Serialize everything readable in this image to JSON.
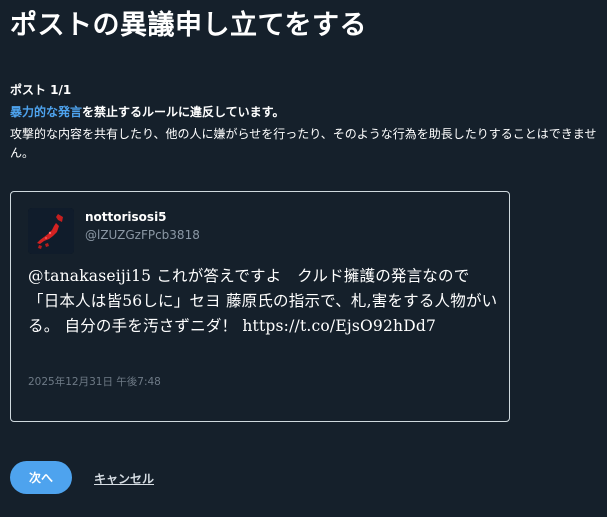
{
  "page": {
    "title": "ポストの異議申し立てをする"
  },
  "report": {
    "counter": "ポスト 1/1",
    "rule_link": "暴力的な発言",
    "violation_suffix": "を禁止するルールに違反しています。",
    "description": "攻撃的な内容を共有したり、他の人に嫌がらせを行ったり、そのような行為を助長したりすることはできません。"
  },
  "post": {
    "display_name": "nottorisosi5",
    "handle": "@lZUZGzFPcb3818",
    "avatar_icon": "japan-map-avatar-icon",
    "text": "@tanakaseiji15 これが答えですよ　クルド擁護の発言なので「日本人は皆56しに」セヨ 藤原氏の指示で、札,害をする人物がいる。 自分の手を汚さずニダ！ https://t.co/EjsO92hDd7",
    "date": "2025年12月31日 午後7:48"
  },
  "actions": {
    "next_label": "次へ",
    "cancel_label": "キャンセル"
  },
  "colors": {
    "background": "#15202b",
    "accent": "#4ea3ee",
    "border": "#cfd9de",
    "muted_text": "#8b98a5"
  }
}
